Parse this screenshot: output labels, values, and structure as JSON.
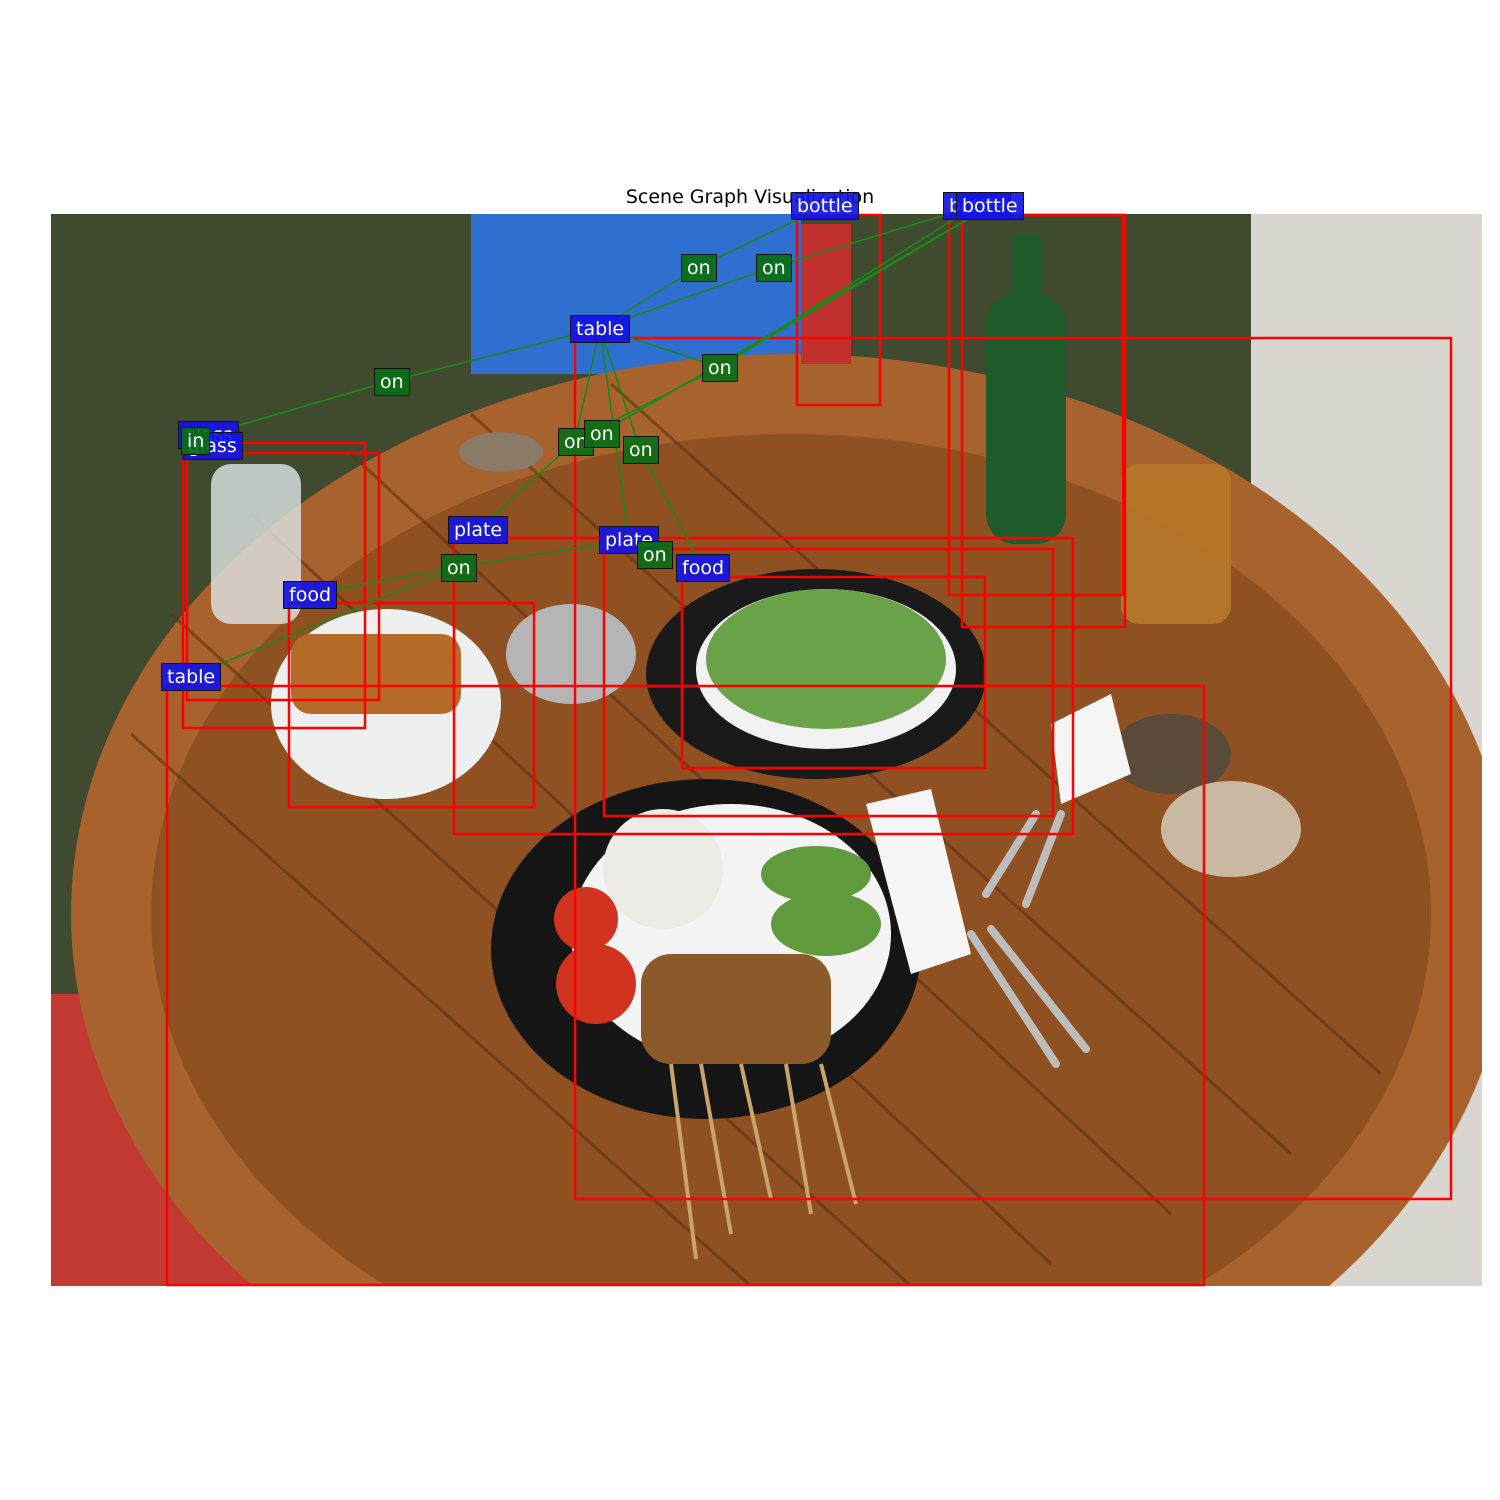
{
  "title": "Scene Graph Visualization",
  "colors": {
    "box": "#ff0000",
    "object_label": "#1414e6",
    "relation_label": "#0a6e14",
    "edge": "#1a8a1a"
  },
  "objects": [
    {
      "id": "bottle-1",
      "label": "bottle"
    },
    {
      "id": "bottle-2",
      "label": "bottle"
    },
    {
      "id": "bottle-3",
      "label": "bottle"
    },
    {
      "id": "table-1",
      "label": "table"
    },
    {
      "id": "table-2",
      "label": "table"
    },
    {
      "id": "glass-1",
      "label": "glass"
    },
    {
      "id": "glass-2",
      "label": "glass"
    },
    {
      "id": "plate-1",
      "label": "plate"
    },
    {
      "id": "plate-2",
      "label": "plate"
    },
    {
      "id": "food-1",
      "label": "food"
    },
    {
      "id": "food-2",
      "label": "food"
    }
  ],
  "relations": [
    {
      "label": "on"
    },
    {
      "label": "on"
    },
    {
      "label": "on"
    },
    {
      "label": "on"
    },
    {
      "label": "in"
    },
    {
      "label": "on"
    },
    {
      "label": "on"
    },
    {
      "label": "on"
    },
    {
      "label": "on"
    },
    {
      "label": "on"
    }
  ]
}
